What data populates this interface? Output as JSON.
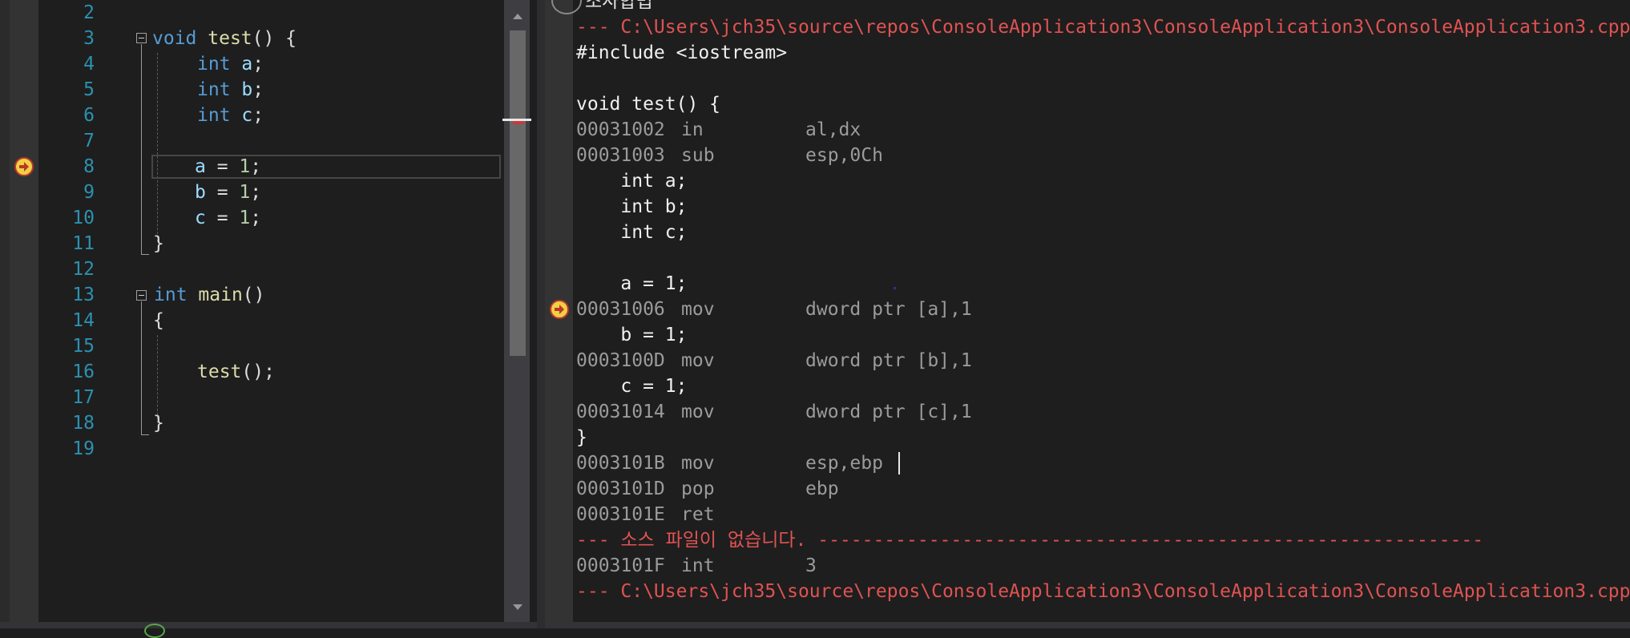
{
  "source_editor": {
    "line_numbers": [
      "2",
      "3",
      "4",
      "5",
      "6",
      "7",
      "8",
      "9",
      "10",
      "11",
      "12",
      "13",
      "14",
      "15",
      "16",
      "17",
      "18",
      "19"
    ],
    "lines": {
      "l3": {
        "kw": "void",
        "fn": "test",
        "rest": "() {"
      },
      "l4": {
        "kw": "int",
        "var": "a",
        "rest": ";"
      },
      "l5": {
        "kw": "int",
        "var": "b",
        "rest": ";"
      },
      "l6": {
        "kw": "int",
        "var": "c",
        "rest": ";"
      },
      "l8": {
        "var": "a",
        "op": " = ",
        "num": "1",
        "rest": ";"
      },
      "l9": {
        "var": "b",
        "op": " = ",
        "num": "1",
        "rest": ";"
      },
      "l10": {
        "var": "c",
        "op": " = ",
        "num": "1",
        "rest": ";"
      },
      "l11": "}",
      "l13": {
        "kw": "int",
        "fn": "main",
        "rest": "()"
      },
      "l14": "{",
      "l16": {
        "fn": "test",
        "rest": "();"
      },
      "l18": "}"
    },
    "current_line": "8",
    "icons": {
      "current_statement": "yellow-arrow-icon"
    }
  },
  "disassembly": {
    "title": "조사합법",
    "lines": [
      {
        "kind": "path",
        "text": "--- C:\\Users\\jch35\\source\\repos\\ConsoleApplication3\\ConsoleApplication3\\ConsoleApplication3.cpp"
      },
      {
        "kind": "src",
        "text": "#include <iostream>"
      },
      {
        "kind": "src",
        "text": ""
      },
      {
        "kind": "src",
        "text": "void test() {"
      },
      {
        "kind": "asm",
        "addr": "00031002",
        "op": "in",
        "args": "al,dx"
      },
      {
        "kind": "asm",
        "addr": "00031003",
        "op": "sub",
        "args": "esp,0Ch"
      },
      {
        "kind": "src",
        "text": "    int a;"
      },
      {
        "kind": "src",
        "text": "    int b;"
      },
      {
        "kind": "src",
        "text": "    int c;"
      },
      {
        "kind": "src",
        "text": ""
      },
      {
        "kind": "src",
        "text": "    a = 1;"
      },
      {
        "kind": "asm",
        "addr": "00031006",
        "op": "mov",
        "args": "dword ptr [a],1"
      },
      {
        "kind": "src",
        "text": "    b = 1;"
      },
      {
        "kind": "asm",
        "addr": "0003100D",
        "op": "mov",
        "args": "dword ptr [b],1"
      },
      {
        "kind": "src",
        "text": "    c = 1;"
      },
      {
        "kind": "asm",
        "addr": "00031014",
        "op": "mov",
        "args": "dword ptr [c],1"
      },
      {
        "kind": "src",
        "text": "}"
      },
      {
        "kind": "asm",
        "addr": "0003101B",
        "op": "mov",
        "args": "esp,ebp"
      },
      {
        "kind": "asm",
        "addr": "0003101D",
        "op": "pop",
        "args": "ebp"
      },
      {
        "kind": "asm",
        "addr": "0003101E",
        "op": "ret",
        "args": ""
      },
      {
        "kind": "path",
        "text": "--- 소스 파일이 없습니다. ------------------------------------------------------------"
      },
      {
        "kind": "asm",
        "addr": "0003101F",
        "op": "int",
        "args": "3"
      },
      {
        "kind": "path",
        "text": "--- C:\\Users\\jch35\\source\\repos\\ConsoleApplication3\\ConsoleApplication3\\ConsoleApplication3.cpp"
      }
    ],
    "current_address": "00031006"
  },
  "colors": {
    "background": "#1e1e1e",
    "line_number": "#2b91af",
    "keyword": "#569cd6",
    "function": "#dcdcaa",
    "variable": "#9cdcfe",
    "number": "#b5cea8",
    "path_red": "#e05252",
    "address_gray": "#9b9b9b"
  }
}
